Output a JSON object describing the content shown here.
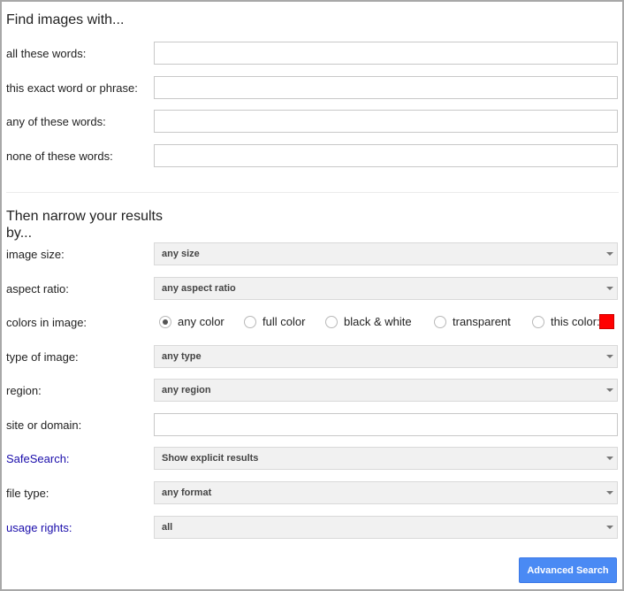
{
  "section1": {
    "heading": "Find images with..."
  },
  "fields": {
    "all_words": {
      "label": "all these words:",
      "value": ""
    },
    "exact_phrase": {
      "label": "this exact word or phrase:",
      "value": ""
    },
    "any_words": {
      "label": "any of these words:",
      "value": ""
    },
    "none_words": {
      "label": "none of these words:",
      "value": ""
    },
    "site_domain": {
      "label": "site or domain:",
      "value": ""
    }
  },
  "section2": {
    "heading_line1": "Then narrow your results",
    "heading_line2": "by..."
  },
  "dropdowns": {
    "image_size": {
      "label": "image size:",
      "value": "any size"
    },
    "aspect_ratio": {
      "label": "aspect ratio:",
      "value": "any aspect ratio"
    },
    "type_of_image": {
      "label": "type of image:",
      "value": "any type"
    },
    "region": {
      "label": "region:",
      "value": "any region"
    },
    "safesearch": {
      "label": "SafeSearch:",
      "value": "Show explicit results"
    },
    "file_type": {
      "label": "file type:",
      "value": "any format"
    },
    "usage_rights": {
      "label": "usage rights:",
      "value": "all"
    }
  },
  "colors": {
    "label": "colors in image:",
    "options": [
      "any color",
      "full color",
      "black & white",
      "transparent",
      "this color:"
    ],
    "selected": "any color",
    "swatch_color": "#ff0000"
  },
  "submit": {
    "label": "Advanced Search"
  },
  "theme": {
    "accent": "#4a8af4",
    "link": "#1a0dab"
  }
}
